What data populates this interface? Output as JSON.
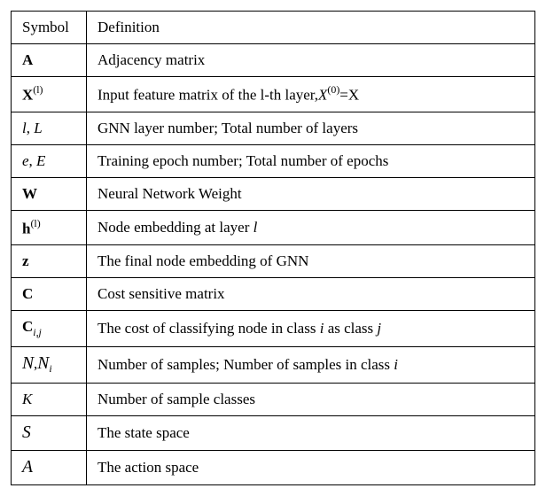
{
  "chart_data": {
    "type": "table",
    "title": "",
    "columns": [
      "Symbol",
      "Definition"
    ],
    "rows": [
      {
        "symbol": "A (bold)",
        "definition": "Adjacency matrix"
      },
      {
        "symbol": "X^(l) (bold)",
        "definition": "Input feature matrix of the l-th layer, X^(0)=X"
      },
      {
        "symbol": "l, L",
        "definition": "GNN layer number; Total number of layers"
      },
      {
        "symbol": "e, E",
        "definition": "Training epoch number; Total number of epochs"
      },
      {
        "symbol": "W (bold)",
        "definition": "Neural Network Weight"
      },
      {
        "symbol": "h^(l) (bold)",
        "definition": "Node embedding at layer l"
      },
      {
        "symbol": "z (bold)",
        "definition": "The final node embedding of GNN"
      },
      {
        "symbol": "C (bold)",
        "definition": "Cost sensitive matrix"
      },
      {
        "symbol": "C_{i,j} (bold)",
        "definition": "The cost of classifying node in class i as class j"
      },
      {
        "symbol": "N, N_i (calligraphic)",
        "definition": "Number of samples; Number of samples in class i"
      },
      {
        "symbol": "K",
        "definition": "Number of sample classes"
      },
      {
        "symbol": "S (calligraphic)",
        "definition": "The state space"
      },
      {
        "symbol": "A (calligraphic)",
        "definition": "The action space"
      }
    ]
  },
  "header": {
    "symbol": "Symbol",
    "definition": "Definition"
  },
  "rows": {
    "r0": {
      "def": "Adjacency matrix"
    },
    "r1": {
      "def_prefix": "Input feature matrix of the l-th layer,",
      "def_x": "X",
      "def_sup": "(0)",
      "def_eq": "=X"
    },
    "r2": {
      "def": "GNN layer number; Total number of layers"
    },
    "r3": {
      "def": "Training epoch number; Total number of epochs"
    },
    "r4": {
      "def": "Neural Network Weight"
    },
    "r5": {
      "def_prefix": "Node embedding at layer ",
      "def_l": "l"
    },
    "r6": {
      "def": "The final node embedding of GNN"
    },
    "r7": {
      "def": "Cost sensitive matrix"
    },
    "r8": {
      "def_prefix": "The cost of classifying node in class ",
      "def_i": "i",
      "def_mid": " as class ",
      "def_j": "j"
    },
    "r9": {
      "def_prefix": "Number of samples; Number of samples in class ",
      "def_i": "i"
    },
    "r10": {
      "def": "Number of sample classes"
    },
    "r11": {
      "def": "The state space"
    },
    "r12": {
      "def": "The action space"
    }
  },
  "sym": {
    "A_bold": "A",
    "X_bold": "X",
    "sup_l": "(l)",
    "sup_0": "(0)",
    "l": "l",
    "L": "L",
    "e": "e",
    "E": "E",
    "W_bold": "W",
    "h_bold": "h",
    "z_bold": "z",
    "C_bold": "C",
    "sub_ij": "i,j",
    "N_cal": "N",
    "comma": ",",
    "sub_i": "i",
    "K": "K",
    "S_cal": "S",
    "A_cal": "A"
  }
}
